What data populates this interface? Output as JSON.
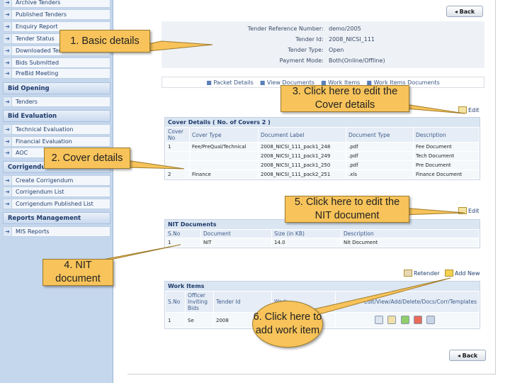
{
  "sidebar": {
    "items": [
      {
        "label": "Archive Tenders"
      },
      {
        "label": "Published Tenders"
      },
      {
        "label": "Enquiry Report"
      },
      {
        "label": "Tender Status"
      },
      {
        "label": "Downloaded Tenders"
      },
      {
        "label": "Bids Submitted"
      },
      {
        "label": "PreBid Meeting"
      }
    ],
    "bid_opening_head": "Bid Opening",
    "bid_opening_items": [
      {
        "label": "Tenders"
      }
    ],
    "bid_evaluation_head": "Bid Evaluation",
    "bid_evaluation_items": [
      {
        "label": "Technical Evaluation"
      },
      {
        "label": "Financial Evaluation"
      },
      {
        "label": "AOC"
      }
    ],
    "corrigendum_head": "Corrigendum",
    "corrigendum_items": [
      {
        "label": "Create Corrigendum"
      },
      {
        "label": "Corrigendum List"
      },
      {
        "label": "Corrigendum Published List"
      }
    ],
    "reports_head": "Reports Management",
    "reports_items": [
      {
        "label": "MIS Reports"
      }
    ]
  },
  "back_label": "Back",
  "tender_info": {
    "rows": [
      {
        "key": "Tender Reference Number",
        "value": "demo/2005"
      },
      {
        "key": "Tender Id",
        "value": "2008_NICSI_111"
      },
      {
        "key": "Tender Type",
        "value": "Open"
      },
      {
        "key": "Payment Mode",
        "value": "Both(Online/Offline)"
      }
    ]
  },
  "doc_links": [
    "Packet Details",
    "View Documents",
    "Work Items",
    "Work Items Documents"
  ],
  "edit_label": "Edit",
  "cover_details": {
    "title": "Cover Details ( No. of Covers 2 )",
    "headers": [
      "Cover No",
      "Cover Type",
      "Document Label",
      "Document Type",
      "Description"
    ],
    "rows": [
      [
        "1",
        "Fee/PreQual/Technical",
        "2008_NICSI_111_pack1_248",
        ".pdf",
        "Fee Document"
      ],
      [
        "",
        "",
        "2008_NICSI_111_pack1_249",
        ".pdf",
        "Tech Document"
      ],
      [
        "",
        "",
        "2008_NICSI_111_pack1_250",
        ".pdf",
        "Pre Document"
      ],
      [
        "2",
        "Finance",
        "2008_NICSI_111_pack2_251",
        ".xls",
        "Finance Document"
      ]
    ]
  },
  "nit_documents": {
    "title": "NIT Documents",
    "headers": [
      "S.No",
      "Document",
      "Size (in KB)",
      "Description"
    ],
    "rows": [
      [
        "1",
        "NIT",
        "14.0",
        "Nit Document"
      ]
    ]
  },
  "retender_label": "Retender",
  "add_new_label": "Add New",
  "work_items": {
    "title": "Work Items",
    "headers": [
      "S.No",
      "Officer Inviting Bids",
      "Tender Id",
      "Work",
      "Edit/View/Add/Delete/Docs/Corr/Templates"
    ],
    "rows": [
      [
        "1",
        "Se",
        "2008",
        "",
        ""
      ]
    ]
  },
  "callouts": {
    "basic": "1. Basic details",
    "cover": "2. Cover details",
    "edit_cover": "3. Click here to edit the Cover details",
    "nit": "4. NIT document",
    "edit_nit": "5. Click here to edit the NIT document",
    "add_work": "6. Click here to add work item"
  },
  "colors": {
    "callout": "#f7c35a",
    "sidebar": "#c5d7ec",
    "header": "#dbe6f3"
  }
}
